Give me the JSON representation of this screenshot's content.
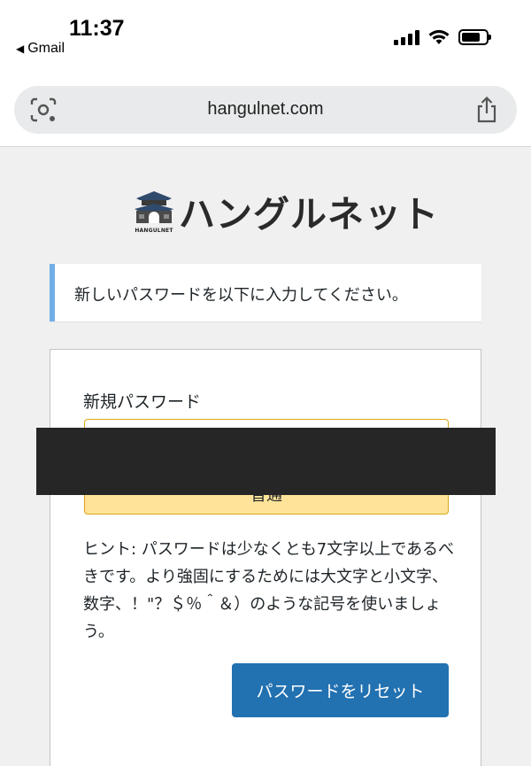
{
  "status_bar": {
    "time": "11:37",
    "back_app": "Gmail",
    "back_arrow": "◀"
  },
  "browser": {
    "url": "hangulnet.com",
    "left_icon": "camera-search-icon",
    "right_icon": "share-icon"
  },
  "logo": {
    "mark_text": "HANGULNET",
    "text": "ハングルネット"
  },
  "notice": {
    "text": "新しいパスワードを以下に入力してください。",
    "accent_color": "#72aee6"
  },
  "form": {
    "label": "新規パスワード",
    "password_value": "",
    "strength_text": "普通",
    "strength_color": "#ffe399",
    "hint": "ヒント: パスワードは少なくとも7文字以上であるべきです。より強固にするためには大文字と小文字、数字、！\"？＄％＾＆）のような記号を使いましょう。",
    "submit_label": "パスワードをリセット",
    "submit_color": "#2271b1"
  }
}
